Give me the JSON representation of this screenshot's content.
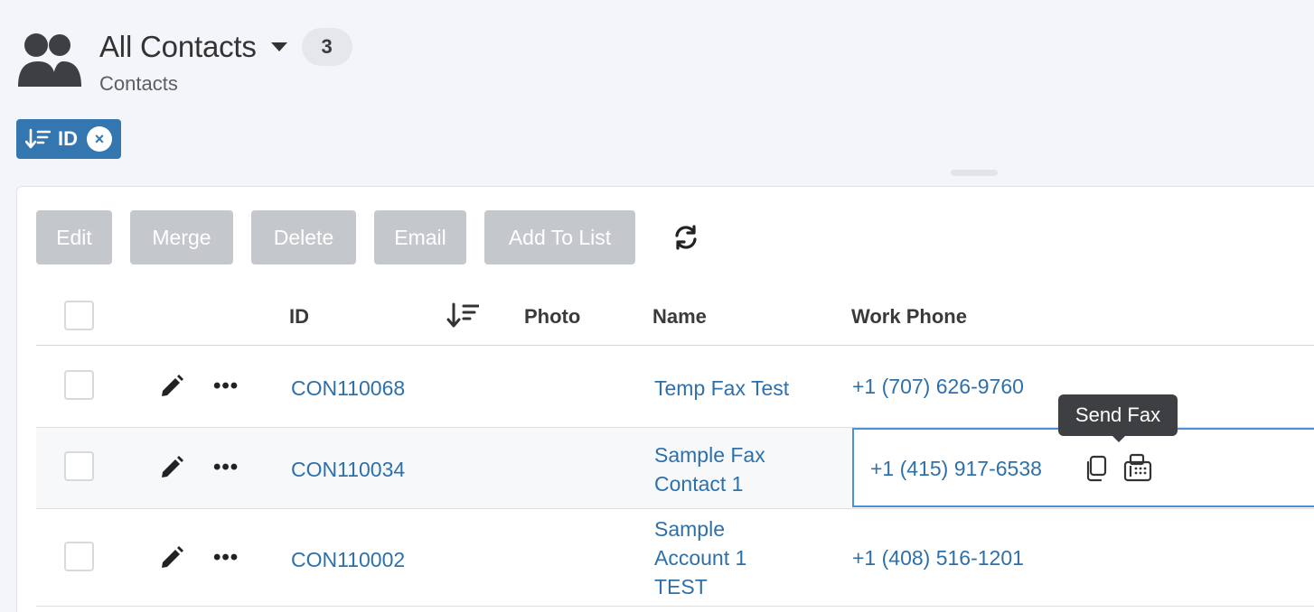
{
  "header": {
    "title": "All Contacts",
    "count": "3",
    "subtitle": "Contacts",
    "icon": "contacts-group-icon"
  },
  "sort_chip": {
    "label": "ID",
    "icon": "sort-descending-icon",
    "close": "×"
  },
  "toolbar": {
    "edit": "Edit",
    "merge": "Merge",
    "delete": "Delete",
    "email": "Email",
    "add_to_list": "Add To List",
    "refresh_icon": "refresh-icon"
  },
  "table": {
    "columns": {
      "id": "ID",
      "photo": "Photo",
      "name": "Name",
      "work_phone": "Work Phone"
    },
    "rows": [
      {
        "id": "CON110068",
        "name_lines": [
          "Temp Fax Test"
        ],
        "phone": "+1 (707) 626-9760"
      },
      {
        "id": "CON110034",
        "name_lines": [
          "Sample Fax",
          "Contact 1"
        ],
        "phone": "+1 (415) 917-6538"
      },
      {
        "id": "CON110002",
        "name_lines": [
          "Sample",
          "Account 1",
          "TEST"
        ],
        "phone": "+1 (408) 516-1201"
      }
    ]
  },
  "tooltip": {
    "text": "Send Fax"
  },
  "colors": {
    "accent": "#3477b0",
    "link": "#2f70a8",
    "disabled_button": "#c4c7cc",
    "focus_border": "#4a90d9"
  }
}
